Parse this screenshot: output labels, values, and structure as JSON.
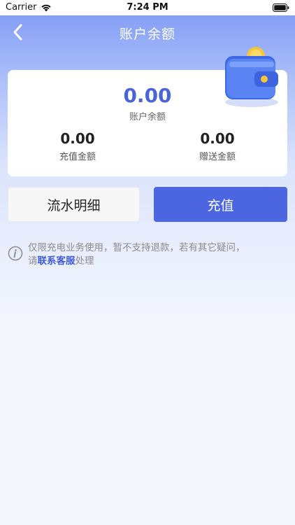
{
  "status_bar": {
    "carrier": "Carrier",
    "time": "7:24 PM"
  },
  "nav": {
    "title": "账户余额"
  },
  "balance": {
    "value": "0.00",
    "label": "账户余额"
  },
  "recharge_amount": {
    "value": "0.00",
    "label": "充值金额"
  },
  "gift_amount": {
    "value": "0.00",
    "label": "赠送金额"
  },
  "buttons": {
    "detail": "流水明细",
    "recharge": "充值"
  },
  "notice": {
    "line1": "仅限充电业务使用，暂不支持退款，若有其它疑问，",
    "prefix": "请",
    "link": "联系客服",
    "suffix": "处理"
  },
  "colors": {
    "accent": "#4b66e0",
    "balance_text": "#4a64d8",
    "link": "#3f5bd9"
  },
  "icons": {
    "back": "chevron-left-icon",
    "wallet": "wallet-illustration",
    "info": "info-icon",
    "wifi": "wifi-icon",
    "battery": "battery-icon"
  }
}
